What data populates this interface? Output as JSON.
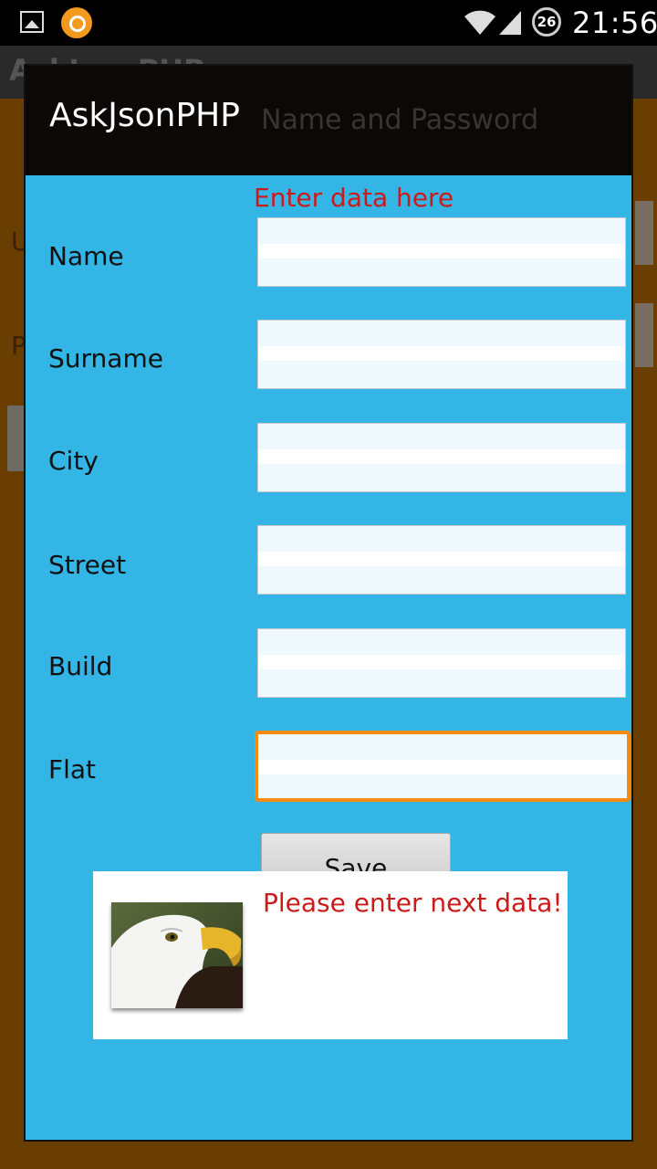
{
  "status_bar": {
    "time": "21:56",
    "badge": "26",
    "icons": [
      "gallery-icon",
      "app-notification-icon",
      "wifi-icon",
      "signal-icon",
      "data-usage-icon"
    ]
  },
  "background_app": {
    "title": "AskJsonPHP",
    "left_label_1": "U",
    "left_label_2": "P"
  },
  "dialog": {
    "title": "AskJsonPHP",
    "ghost_text": "Name and Password",
    "prompt": "Enter data here",
    "fields": [
      {
        "label": "Name",
        "value": ""
      },
      {
        "label": "Surname",
        "value": ""
      },
      {
        "label": "City",
        "value": ""
      },
      {
        "label": "Street",
        "value": ""
      },
      {
        "label": "Build",
        "value": ""
      },
      {
        "label": "Flat",
        "value": ""
      }
    ],
    "save_label": "Save"
  },
  "toast": {
    "message": "Please enter next data!",
    "image": "eagle-image"
  },
  "colors": {
    "dialog_bg": "#33b5e5",
    "prompt_red": "#cc1a1a",
    "focus_orange": "#f38a14",
    "bg_brown": "#6a3d00"
  }
}
